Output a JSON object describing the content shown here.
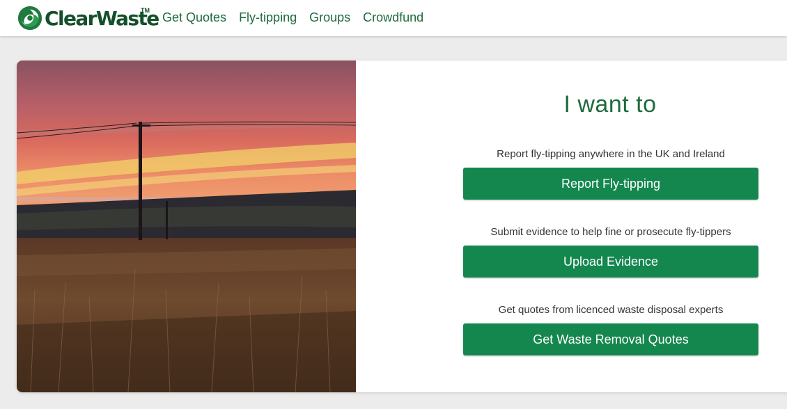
{
  "brand": {
    "name": "ClearWaste",
    "trademark": "TM",
    "logo_icon": "recycle-swirl-icon",
    "colors": {
      "primary": "#14874e",
      "text": "#1e6b3c",
      "dark": "#14502a"
    }
  },
  "nav": {
    "items": [
      {
        "label": "Get Quotes"
      },
      {
        "label": "Fly-tipping"
      },
      {
        "label": "Groups"
      },
      {
        "label": "Crowdfund"
      }
    ]
  },
  "hero": {
    "image": "sunset-field-with-power-pole",
    "heading": "I want to",
    "actions": [
      {
        "description": "Report fly-tipping anywhere in the UK and Ireland",
        "button": "Report Fly-tipping"
      },
      {
        "description": "Submit evidence to help fine or prosecute fly-tippers",
        "button": "Upload Evidence"
      },
      {
        "description": "Get quotes from licenced waste disposal experts",
        "button": "Get Waste Removal Quotes"
      }
    ]
  }
}
